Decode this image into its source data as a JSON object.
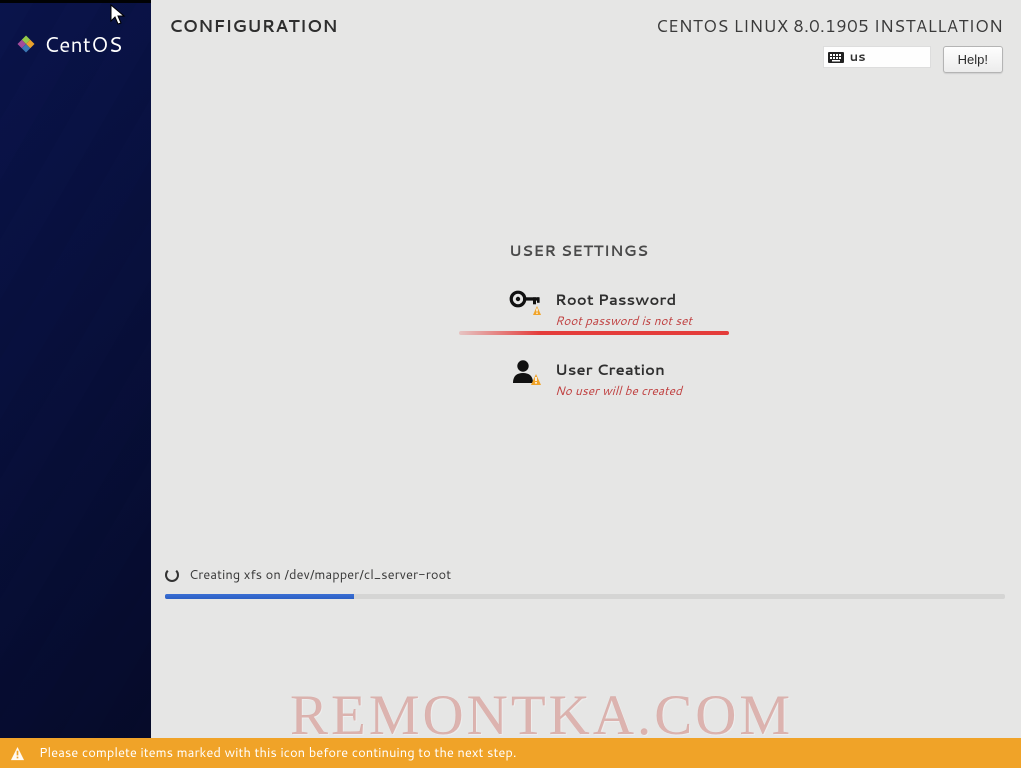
{
  "brand": {
    "name": "CentOS"
  },
  "header": {
    "page_title": "CONFIGURATION",
    "install_title": "CENTOS LINUX 8.0.1905 INSTALLATION",
    "keyboard_layout": "us",
    "help_label": "Help!"
  },
  "user_settings": {
    "section_title": "USER SETTINGS",
    "root_password": {
      "title": "Root Password",
      "status": "Root password is not set",
      "icon": "key-warning-icon"
    },
    "user_creation": {
      "title": "User Creation",
      "status": "No user will be created",
      "icon": "user-warning-icon"
    }
  },
  "progress": {
    "text": "Creating xfs on /dev/mapper/cl_server-root",
    "percent": 22.5
  },
  "warning_bar": {
    "message": "Please complete items marked with this icon before continuing to the next step."
  },
  "watermark": "REMONTKA.COM"
}
